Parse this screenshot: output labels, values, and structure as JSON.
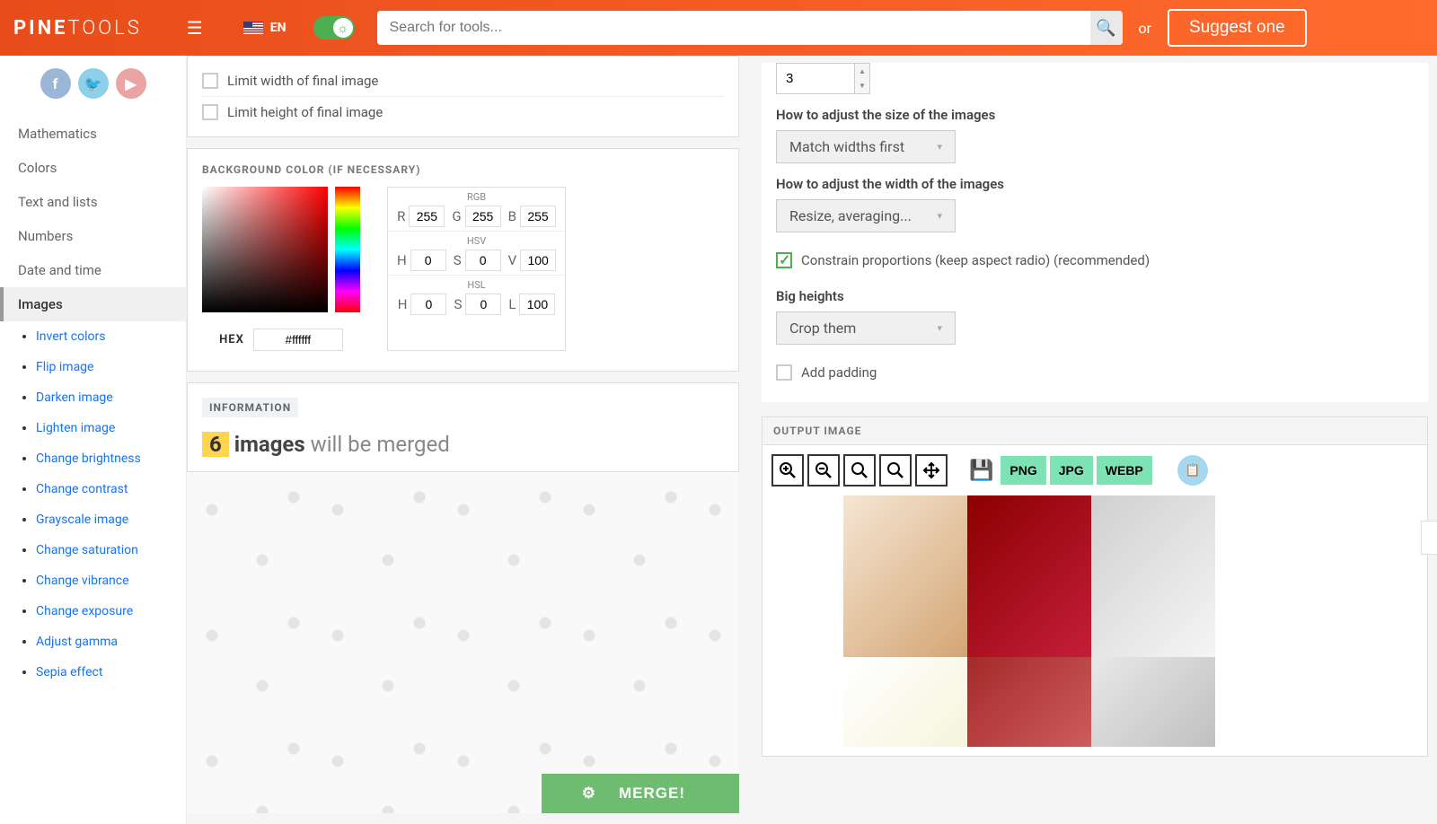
{
  "header": {
    "logo_bold": "PINE",
    "logo_light": "TOOLS",
    "lang": "EN",
    "search_placeholder": "Search for tools...",
    "or_label": "or",
    "suggest_label": "Suggest one"
  },
  "sidebar": {
    "nav": [
      "Mathematics",
      "Colors",
      "Text and lists",
      "Numbers",
      "Date and time",
      "Images"
    ],
    "active_index": 5,
    "sub": [
      "Invert colors",
      "Flip image",
      "Darken image",
      "Lighten image",
      "Change brightness",
      "Change contrast",
      "Grayscale image",
      "Change saturation",
      "Change vibrance",
      "Change exposure",
      "Adjust gamma",
      "Sepia effect"
    ]
  },
  "left": {
    "limit_width": "Limit width of final image",
    "limit_height": "Limit height of final image",
    "bg_title": "BACKGROUND COLOR (IF NECESSARY)",
    "hex_label": "HEX",
    "hex_value": "#ffffff",
    "rgb_label": "RGB",
    "rgb": {
      "r": "255",
      "g": "255",
      "b": "255"
    },
    "hsv_label": "HSV",
    "hsv": {
      "h": "0",
      "s": "0",
      "v": "100"
    },
    "hsl_label": "HSL",
    "hsl": {
      "h": "0",
      "s": "0",
      "l": "100"
    },
    "info_title": "INFORMATION",
    "info_count": "6",
    "info_strong": "images",
    "info_rest": "will be merged",
    "merge_label": "MERGE!"
  },
  "right": {
    "columns_value": "3",
    "size_label": "How to adjust the size of the images",
    "size_value": "Match widths first",
    "width_label": "How to adjust the width of the images",
    "width_value": "Resize, averaging...",
    "constrain": "Constrain proportions (keep aspect radio) (recommended)",
    "bigheights_label": "Big heights",
    "bigheights_value": "Crop them",
    "padding_label": "Add padding",
    "output_title": "OUTPUT IMAGE",
    "formats": [
      "PNG",
      "JPG",
      "WEBP"
    ]
  }
}
